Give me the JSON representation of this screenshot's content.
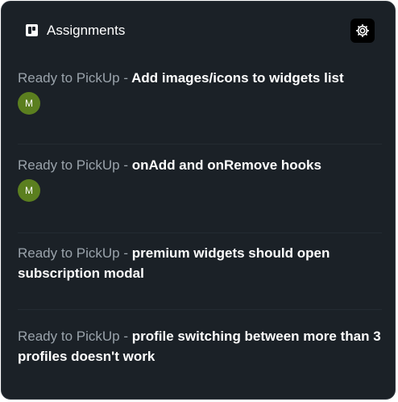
{
  "widget": {
    "title": "Assignments",
    "settings_icon": "gear-icon",
    "brand_icon": "trello-board-icon"
  },
  "items": [
    {
      "status": "Ready to PickUp",
      "separator": "-",
      "title": "Add images/icons to widgets list",
      "avatar": "M"
    },
    {
      "status": "Ready to PickUp",
      "separator": "-",
      "title": "onAdd and onRemove hooks",
      "avatar": "M"
    },
    {
      "status": "Ready to PickUp",
      "separator": "-",
      "title": "premium widgets should open subscription modal"
    },
    {
      "status": "Ready to PickUp",
      "separator": "-",
      "title": "profile switching between more than 3 profiles doesn't work"
    }
  ],
  "colors": {
    "background": "#1b2127",
    "avatar": "#5b7f1f",
    "status_text": "#9aa3ab",
    "title_text": "#ffffff"
  }
}
